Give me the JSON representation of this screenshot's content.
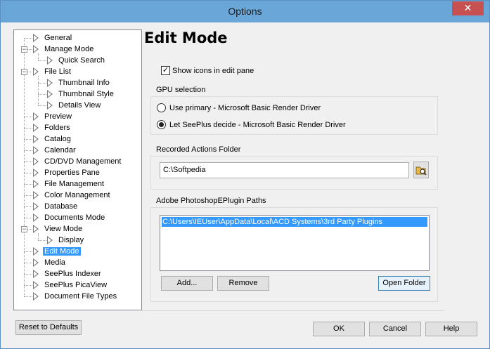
{
  "window": {
    "title": "Options",
    "close_glyph": "✕"
  },
  "tree": {
    "items": [
      {
        "label": "General"
      },
      {
        "label": "Manage Mode"
      },
      {
        "label": "Quick Search"
      },
      {
        "label": "File List"
      },
      {
        "label": "Thumbnail Info"
      },
      {
        "label": "Thumbnail Style"
      },
      {
        "label": "Details View"
      },
      {
        "label": "Preview"
      },
      {
        "label": "Folders"
      },
      {
        "label": "Catalog"
      },
      {
        "label": "Calendar"
      },
      {
        "label": "CD/DVD Management"
      },
      {
        "label": "Properties Pane"
      },
      {
        "label": "File Management"
      },
      {
        "label": "Color Management"
      },
      {
        "label": "Database"
      },
      {
        "label": "Documents Mode"
      },
      {
        "label": "View Mode"
      },
      {
        "label": "Display"
      },
      {
        "label": "Edit Mode"
      },
      {
        "label": "Media"
      },
      {
        "label": "SeePlus Indexer"
      },
      {
        "label": "SeePlus PicaView"
      },
      {
        "label": "Document File Types"
      }
    ],
    "selected": "Edit Mode",
    "expander_glyph": "−"
  },
  "panel": {
    "heading": "Edit Mode",
    "show_icons": {
      "label": "Show icons in edit pane",
      "checked": true,
      "glyph": "✓"
    },
    "gpu": {
      "label": "GPU selection",
      "options": [
        {
          "label": "Use primary - Microsoft Basic Render Driver",
          "selected": false
        },
        {
          "label": "Let SeePlus decide - Microsoft Basic Render Driver",
          "selected": true
        }
      ]
    },
    "recorded": {
      "label": "Recorded Actions Folder",
      "value": "C:\\Softpedia",
      "browse_icon": "folder-browse-icon"
    },
    "plugins": {
      "label": "Adobe PhotoshopEPlugin Paths",
      "paths": [
        "C:\\Users\\IEUser\\AppData\\Local\\ACD Systems\\3rd Party Plugins"
      ],
      "add_label": "Add...",
      "remove_label": "Remove",
      "open_label": "Open Folder"
    }
  },
  "footer": {
    "reset_label": "Reset to Defaults",
    "ok_label": "OK",
    "cancel_label": "Cancel",
    "help_label": "Help"
  }
}
